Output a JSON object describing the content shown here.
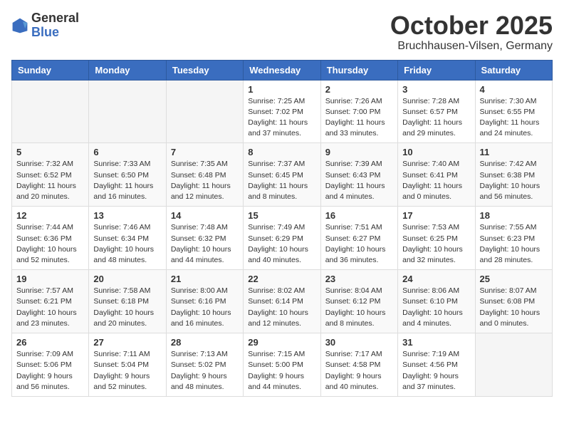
{
  "logo": {
    "general": "General",
    "blue": "Blue"
  },
  "header": {
    "month": "October 2025",
    "location": "Bruchhausen-Vilsen, Germany"
  },
  "weekdays": [
    "Sunday",
    "Monday",
    "Tuesday",
    "Wednesday",
    "Thursday",
    "Friday",
    "Saturday"
  ],
  "weeks": [
    [
      {
        "day": "",
        "info": ""
      },
      {
        "day": "",
        "info": ""
      },
      {
        "day": "",
        "info": ""
      },
      {
        "day": "1",
        "info": "Sunrise: 7:25 AM\nSunset: 7:02 PM\nDaylight: 11 hours\nand 37 minutes."
      },
      {
        "day": "2",
        "info": "Sunrise: 7:26 AM\nSunset: 7:00 PM\nDaylight: 11 hours\nand 33 minutes."
      },
      {
        "day": "3",
        "info": "Sunrise: 7:28 AM\nSunset: 6:57 PM\nDaylight: 11 hours\nand 29 minutes."
      },
      {
        "day": "4",
        "info": "Sunrise: 7:30 AM\nSunset: 6:55 PM\nDaylight: 11 hours\nand 24 minutes."
      }
    ],
    [
      {
        "day": "5",
        "info": "Sunrise: 7:32 AM\nSunset: 6:52 PM\nDaylight: 11 hours\nand 20 minutes."
      },
      {
        "day": "6",
        "info": "Sunrise: 7:33 AM\nSunset: 6:50 PM\nDaylight: 11 hours\nand 16 minutes."
      },
      {
        "day": "7",
        "info": "Sunrise: 7:35 AM\nSunset: 6:48 PM\nDaylight: 11 hours\nand 12 minutes."
      },
      {
        "day": "8",
        "info": "Sunrise: 7:37 AM\nSunset: 6:45 PM\nDaylight: 11 hours\nand 8 minutes."
      },
      {
        "day": "9",
        "info": "Sunrise: 7:39 AM\nSunset: 6:43 PM\nDaylight: 11 hours\nand 4 minutes."
      },
      {
        "day": "10",
        "info": "Sunrise: 7:40 AM\nSunset: 6:41 PM\nDaylight: 11 hours\nand 0 minutes."
      },
      {
        "day": "11",
        "info": "Sunrise: 7:42 AM\nSunset: 6:38 PM\nDaylight: 10 hours\nand 56 minutes."
      }
    ],
    [
      {
        "day": "12",
        "info": "Sunrise: 7:44 AM\nSunset: 6:36 PM\nDaylight: 10 hours\nand 52 minutes."
      },
      {
        "day": "13",
        "info": "Sunrise: 7:46 AM\nSunset: 6:34 PM\nDaylight: 10 hours\nand 48 minutes."
      },
      {
        "day": "14",
        "info": "Sunrise: 7:48 AM\nSunset: 6:32 PM\nDaylight: 10 hours\nand 44 minutes."
      },
      {
        "day": "15",
        "info": "Sunrise: 7:49 AM\nSunset: 6:29 PM\nDaylight: 10 hours\nand 40 minutes."
      },
      {
        "day": "16",
        "info": "Sunrise: 7:51 AM\nSunset: 6:27 PM\nDaylight: 10 hours\nand 36 minutes."
      },
      {
        "day": "17",
        "info": "Sunrise: 7:53 AM\nSunset: 6:25 PM\nDaylight: 10 hours\nand 32 minutes."
      },
      {
        "day": "18",
        "info": "Sunrise: 7:55 AM\nSunset: 6:23 PM\nDaylight: 10 hours\nand 28 minutes."
      }
    ],
    [
      {
        "day": "19",
        "info": "Sunrise: 7:57 AM\nSunset: 6:21 PM\nDaylight: 10 hours\nand 23 minutes."
      },
      {
        "day": "20",
        "info": "Sunrise: 7:58 AM\nSunset: 6:18 PM\nDaylight: 10 hours\nand 20 minutes."
      },
      {
        "day": "21",
        "info": "Sunrise: 8:00 AM\nSunset: 6:16 PM\nDaylight: 10 hours\nand 16 minutes."
      },
      {
        "day": "22",
        "info": "Sunrise: 8:02 AM\nSunset: 6:14 PM\nDaylight: 10 hours\nand 12 minutes."
      },
      {
        "day": "23",
        "info": "Sunrise: 8:04 AM\nSunset: 6:12 PM\nDaylight: 10 hours\nand 8 minutes."
      },
      {
        "day": "24",
        "info": "Sunrise: 8:06 AM\nSunset: 6:10 PM\nDaylight: 10 hours\nand 4 minutes."
      },
      {
        "day": "25",
        "info": "Sunrise: 8:07 AM\nSunset: 6:08 PM\nDaylight: 10 hours\nand 0 minutes."
      }
    ],
    [
      {
        "day": "26",
        "info": "Sunrise: 7:09 AM\nSunset: 5:06 PM\nDaylight: 9 hours\nand 56 minutes."
      },
      {
        "day": "27",
        "info": "Sunrise: 7:11 AM\nSunset: 5:04 PM\nDaylight: 9 hours\nand 52 minutes."
      },
      {
        "day": "28",
        "info": "Sunrise: 7:13 AM\nSunset: 5:02 PM\nDaylight: 9 hours\nand 48 minutes."
      },
      {
        "day": "29",
        "info": "Sunrise: 7:15 AM\nSunset: 5:00 PM\nDaylight: 9 hours\nand 44 minutes."
      },
      {
        "day": "30",
        "info": "Sunrise: 7:17 AM\nSunset: 4:58 PM\nDaylight: 9 hours\nand 40 minutes."
      },
      {
        "day": "31",
        "info": "Sunrise: 7:19 AM\nSunset: 4:56 PM\nDaylight: 9 hours\nand 37 minutes."
      },
      {
        "day": "",
        "info": ""
      }
    ]
  ]
}
